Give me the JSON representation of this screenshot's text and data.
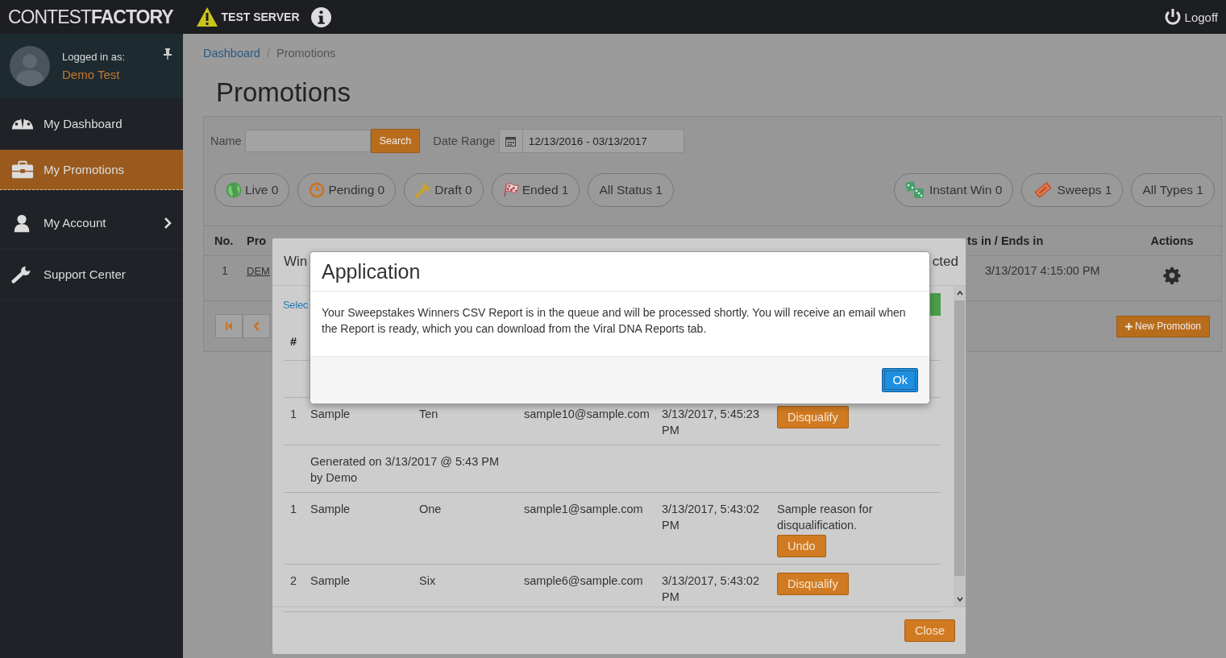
{
  "header": {
    "brand_light": "CONTEST",
    "brand_bold": "FACTORY",
    "server_label": "TEST SERVER",
    "logoff": "Logoff"
  },
  "user": {
    "caption": "Logged in as:",
    "name": "Demo Test"
  },
  "sidebar": {
    "items": [
      {
        "label": "My Dashboard",
        "kind": "dashboard",
        "selected": false,
        "has_submenu": false
      },
      {
        "label": "My Promotions",
        "kind": "promotions",
        "selected": true,
        "has_submenu": false
      },
      {
        "label": "My Account",
        "kind": "account",
        "selected": false,
        "has_submenu": true
      },
      {
        "label": "Support Center",
        "kind": "support",
        "selected": false,
        "has_submenu": false
      }
    ]
  },
  "breadcrumb": [
    {
      "label": "Dashboard",
      "kind": "link"
    },
    {
      "label": "/",
      "kind": "separator"
    },
    {
      "label": "Promotions",
      "kind": "current"
    }
  ],
  "page_title": "Promotions",
  "filters": {
    "name_label": "Name",
    "search_button": "Search",
    "date_label": "Date Range",
    "date_value": "12/13/2016 - 03/13/2017"
  },
  "status_pills": [
    {
      "label": "Live 0",
      "kind": "live"
    },
    {
      "label": "Pending 0",
      "kind": "pending"
    },
    {
      "label": "Draft 0",
      "kind": "draft"
    },
    {
      "label": "Ended 1",
      "kind": "ended"
    },
    {
      "label": "All Status 1",
      "kind": "all"
    }
  ],
  "type_pills": [
    {
      "label": "Instant Win 0",
      "kind": "instant"
    },
    {
      "label": "Sweeps 1",
      "kind": "sweeps"
    },
    {
      "label": "All Types 1",
      "kind": "all"
    }
  ],
  "table": {
    "columns": [
      "No.",
      "Pro",
      "ts in / Ends in",
      "Actions"
    ],
    "rows": [
      {
        "no": "1",
        "promotion": "DEM",
        "starts": "3/13/2017 4:15:00 PM"
      }
    ]
  },
  "new_button": "New Promotion",
  "winners_modal": {
    "title_start": "Win",
    "title_end": "cted",
    "select_link": "Selec",
    "columns": [
      "#"
    ],
    "rows": [
      {
        "kind": "entry",
        "no": "1",
        "first": "Sample",
        "last": "Ten",
        "email": "sample10@sample.com",
        "date": "3/13/2017, 5:45:23 PM",
        "action": "Disqualify"
      },
      {
        "kind": "group",
        "text": "Generated on 3/13/2017 @ 5:43 PM by Demo"
      },
      {
        "kind": "entry",
        "no": "1",
        "first": "Sample",
        "last": "One",
        "email": "sample1@sample.com",
        "date": "3/13/2017, 5:43:02 PM",
        "reason": "Sample reason for disqualification.",
        "action": "Undo"
      },
      {
        "kind": "entry",
        "no": "2",
        "first": "Sample",
        "last": "Six",
        "email": "sample6@sample.com",
        "date": "3/13/2017, 5:43:02 PM",
        "action": "Disqualify"
      }
    ],
    "close_button": "Close"
  },
  "dialog": {
    "title": "Application",
    "message": "Your Sweepstakes Winners CSV Report is in the queue and will be processed shortly. You will receive an email when the Report is ready, which you can download from the Viral DNA Reports tab.",
    "ok_button": "Ok"
  }
}
